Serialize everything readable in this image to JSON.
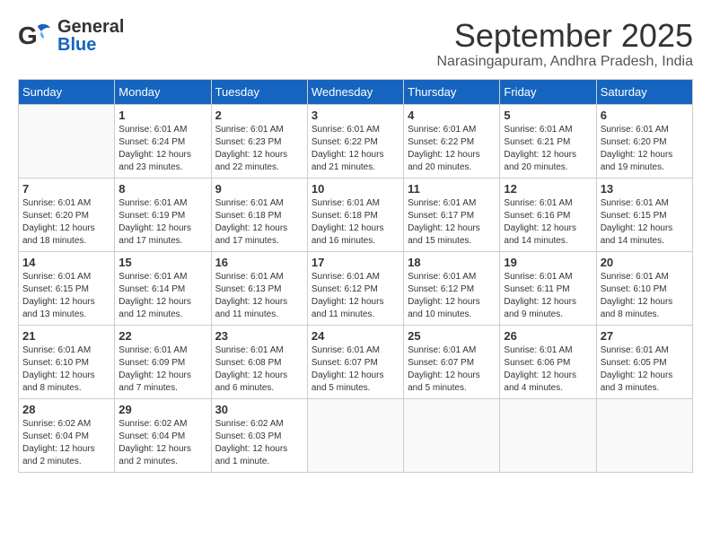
{
  "header": {
    "logo_general": "General",
    "logo_blue": "Blue",
    "month": "September 2025",
    "location": "Narasingapuram, Andhra Pradesh, India"
  },
  "days_of_week": [
    "Sunday",
    "Monday",
    "Tuesday",
    "Wednesday",
    "Thursday",
    "Friday",
    "Saturday"
  ],
  "weeks": [
    [
      {
        "day": "",
        "info": ""
      },
      {
        "day": "1",
        "info": "Sunrise: 6:01 AM\nSunset: 6:24 PM\nDaylight: 12 hours\nand 23 minutes."
      },
      {
        "day": "2",
        "info": "Sunrise: 6:01 AM\nSunset: 6:23 PM\nDaylight: 12 hours\nand 22 minutes."
      },
      {
        "day": "3",
        "info": "Sunrise: 6:01 AM\nSunset: 6:22 PM\nDaylight: 12 hours\nand 21 minutes."
      },
      {
        "day": "4",
        "info": "Sunrise: 6:01 AM\nSunset: 6:22 PM\nDaylight: 12 hours\nand 20 minutes."
      },
      {
        "day": "5",
        "info": "Sunrise: 6:01 AM\nSunset: 6:21 PM\nDaylight: 12 hours\nand 20 minutes."
      },
      {
        "day": "6",
        "info": "Sunrise: 6:01 AM\nSunset: 6:20 PM\nDaylight: 12 hours\nand 19 minutes."
      }
    ],
    [
      {
        "day": "7",
        "info": "Sunrise: 6:01 AM\nSunset: 6:20 PM\nDaylight: 12 hours\nand 18 minutes."
      },
      {
        "day": "8",
        "info": "Sunrise: 6:01 AM\nSunset: 6:19 PM\nDaylight: 12 hours\nand 17 minutes."
      },
      {
        "day": "9",
        "info": "Sunrise: 6:01 AM\nSunset: 6:18 PM\nDaylight: 12 hours\nand 17 minutes."
      },
      {
        "day": "10",
        "info": "Sunrise: 6:01 AM\nSunset: 6:18 PM\nDaylight: 12 hours\nand 16 minutes."
      },
      {
        "day": "11",
        "info": "Sunrise: 6:01 AM\nSunset: 6:17 PM\nDaylight: 12 hours\nand 15 minutes."
      },
      {
        "day": "12",
        "info": "Sunrise: 6:01 AM\nSunset: 6:16 PM\nDaylight: 12 hours\nand 14 minutes."
      },
      {
        "day": "13",
        "info": "Sunrise: 6:01 AM\nSunset: 6:15 PM\nDaylight: 12 hours\nand 14 minutes."
      }
    ],
    [
      {
        "day": "14",
        "info": "Sunrise: 6:01 AM\nSunset: 6:15 PM\nDaylight: 12 hours\nand 13 minutes."
      },
      {
        "day": "15",
        "info": "Sunrise: 6:01 AM\nSunset: 6:14 PM\nDaylight: 12 hours\nand 12 minutes."
      },
      {
        "day": "16",
        "info": "Sunrise: 6:01 AM\nSunset: 6:13 PM\nDaylight: 12 hours\nand 11 minutes."
      },
      {
        "day": "17",
        "info": "Sunrise: 6:01 AM\nSunset: 6:12 PM\nDaylight: 12 hours\nand 11 minutes."
      },
      {
        "day": "18",
        "info": "Sunrise: 6:01 AM\nSunset: 6:12 PM\nDaylight: 12 hours\nand 10 minutes."
      },
      {
        "day": "19",
        "info": "Sunrise: 6:01 AM\nSunset: 6:11 PM\nDaylight: 12 hours\nand 9 minutes."
      },
      {
        "day": "20",
        "info": "Sunrise: 6:01 AM\nSunset: 6:10 PM\nDaylight: 12 hours\nand 8 minutes."
      }
    ],
    [
      {
        "day": "21",
        "info": "Sunrise: 6:01 AM\nSunset: 6:10 PM\nDaylight: 12 hours\nand 8 minutes."
      },
      {
        "day": "22",
        "info": "Sunrise: 6:01 AM\nSunset: 6:09 PM\nDaylight: 12 hours\nand 7 minutes."
      },
      {
        "day": "23",
        "info": "Sunrise: 6:01 AM\nSunset: 6:08 PM\nDaylight: 12 hours\nand 6 minutes."
      },
      {
        "day": "24",
        "info": "Sunrise: 6:01 AM\nSunset: 6:07 PM\nDaylight: 12 hours\nand 5 minutes."
      },
      {
        "day": "25",
        "info": "Sunrise: 6:01 AM\nSunset: 6:07 PM\nDaylight: 12 hours\nand 5 minutes."
      },
      {
        "day": "26",
        "info": "Sunrise: 6:01 AM\nSunset: 6:06 PM\nDaylight: 12 hours\nand 4 minutes."
      },
      {
        "day": "27",
        "info": "Sunrise: 6:01 AM\nSunset: 6:05 PM\nDaylight: 12 hours\nand 3 minutes."
      }
    ],
    [
      {
        "day": "28",
        "info": "Sunrise: 6:02 AM\nSunset: 6:04 PM\nDaylight: 12 hours\nand 2 minutes."
      },
      {
        "day": "29",
        "info": "Sunrise: 6:02 AM\nSunset: 6:04 PM\nDaylight: 12 hours\nand 2 minutes."
      },
      {
        "day": "30",
        "info": "Sunrise: 6:02 AM\nSunset: 6:03 PM\nDaylight: 12 hours\nand 1 minute."
      },
      {
        "day": "",
        "info": ""
      },
      {
        "day": "",
        "info": ""
      },
      {
        "day": "",
        "info": ""
      },
      {
        "day": "",
        "info": ""
      }
    ]
  ]
}
